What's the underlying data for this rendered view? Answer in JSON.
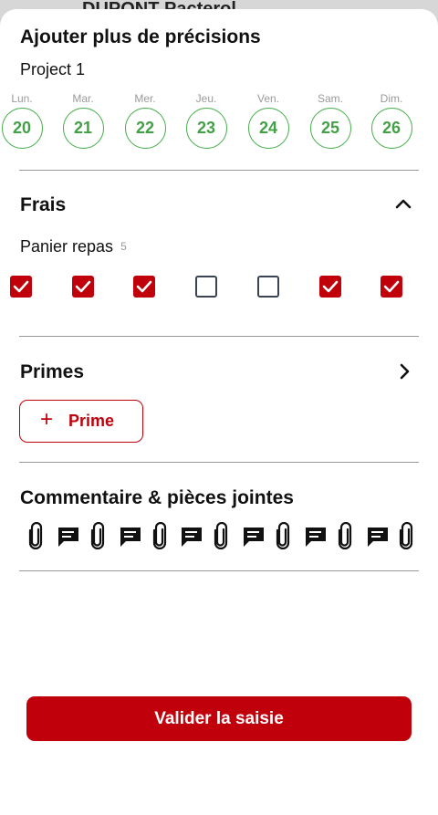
{
  "background": {
    "title": "DUPONT Pacterol"
  },
  "sheet": {
    "title": "Ajouter plus de précisions",
    "project": "Project 1",
    "days": [
      {
        "name": "Lun.",
        "num": "20"
      },
      {
        "name": "Mar.",
        "num": "21"
      },
      {
        "name": "Mer.",
        "num": "22"
      },
      {
        "name": "Jeu.",
        "num": "23"
      },
      {
        "name": "Ven.",
        "num": "24"
      },
      {
        "name": "Sam.",
        "num": "25"
      },
      {
        "name": "Dim.",
        "num": "26"
      }
    ]
  },
  "frais": {
    "title": "Frais",
    "panier_label": "Panier repas",
    "panier_count": "5",
    "checks": [
      true,
      true,
      true,
      false,
      false,
      true,
      true
    ]
  },
  "primes": {
    "title": "Primes",
    "button_label": "Prime",
    "plus": "+"
  },
  "commentaire": {
    "title": "Commentaire & pièces jointes"
  },
  "footer": {
    "validate_label": "Valider la saisie"
  },
  "colors": {
    "accent": "#c0000a",
    "day_green": "#43a047"
  }
}
